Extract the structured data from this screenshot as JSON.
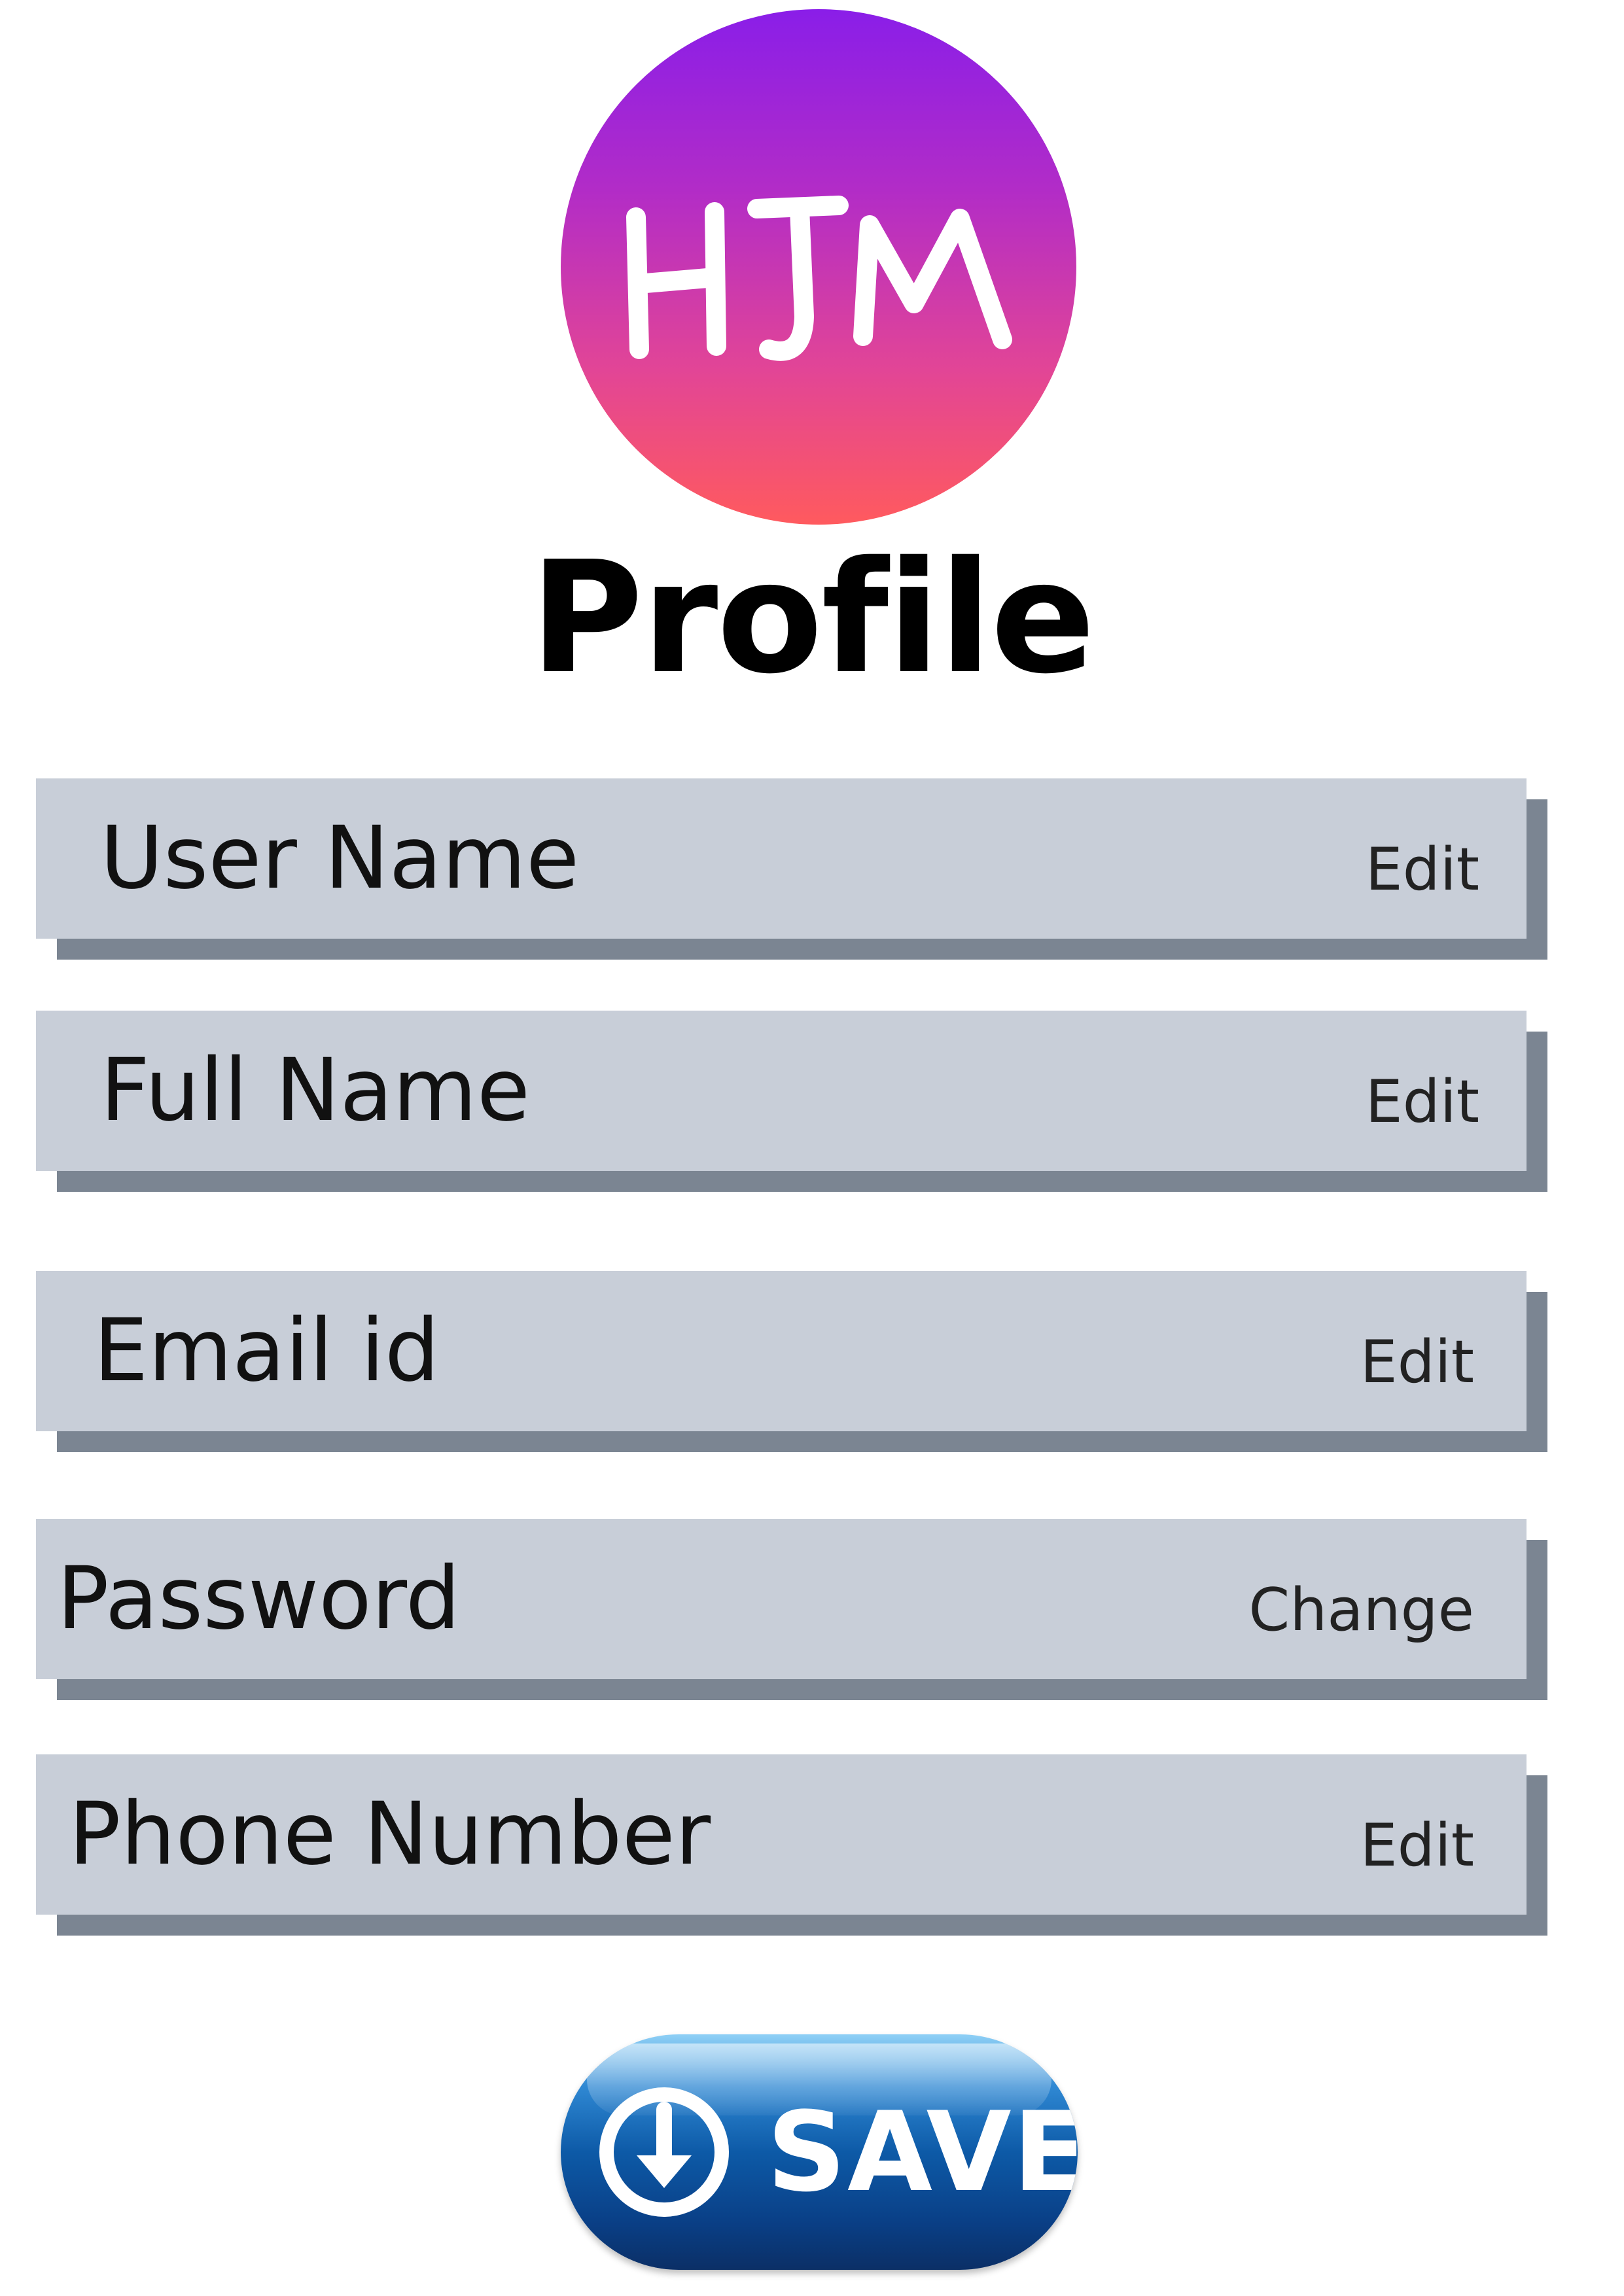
{
  "logo": {
    "text": "HJM",
    "gradient_top": "#8a1ee8",
    "gradient_bottom": "#ff5a5e"
  },
  "page": {
    "title": "Profile"
  },
  "fields": [
    {
      "label": "User Name",
      "action": "Edit"
    },
    {
      "label": "Full Name",
      "action": "Edit"
    },
    {
      "label": "Email id",
      "action": "Edit"
    },
    {
      "label": "Password",
      "action": "Change"
    },
    {
      "label": "Phone Number",
      "action": "Edit"
    }
  ],
  "save_button": {
    "label": "SAVE",
    "icon": "download-arrow-icon"
  },
  "colors": {
    "field_background": "#c8ced8",
    "field_shadow": "#7b8592",
    "save_blue": "#0d5aa7"
  }
}
